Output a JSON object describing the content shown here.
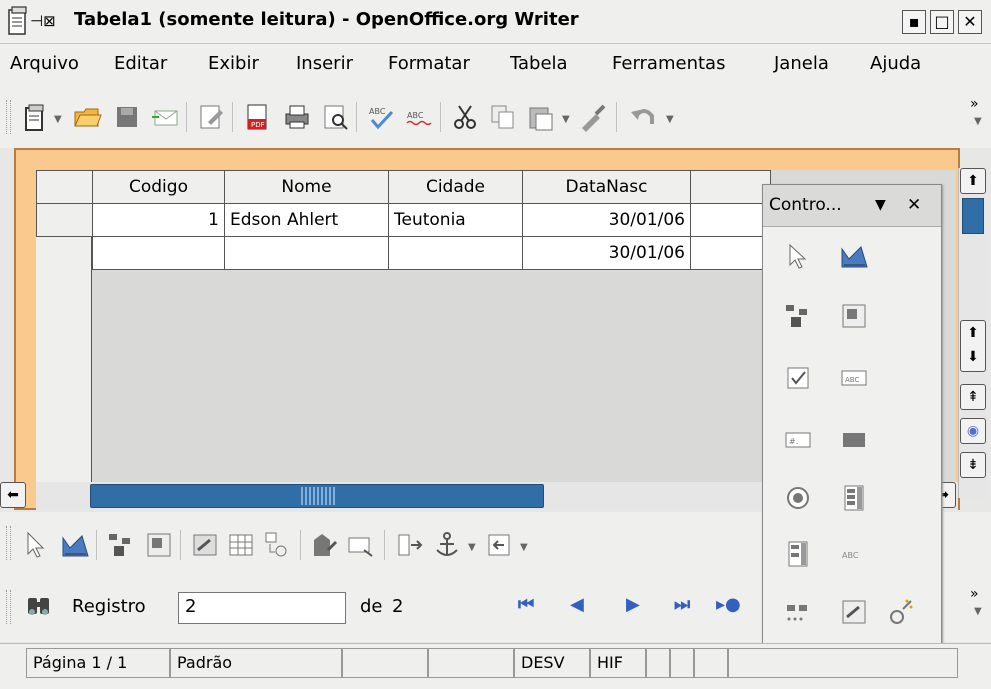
{
  "window": {
    "title": "Tabela1 (somente leitura) - OpenOffice.org Writer",
    "buttons": [
      "▪",
      "□",
      "✕"
    ]
  },
  "menubar": {
    "items": [
      "Arquivo",
      "Editar",
      "Exibir",
      "Inserir",
      "Formatar",
      "Tabela",
      "Ferramentas",
      "Janela",
      "Ajuda"
    ]
  },
  "table": {
    "headers": [
      "Codigo",
      "Nome",
      "Cidade",
      "DataNasc"
    ],
    "rows": [
      {
        "codigo": "1",
        "nome": "Edson Ahlert",
        "cidade": "Teutonia",
        "datanasc": "30/01/06"
      },
      {
        "codigo": "",
        "nome": "",
        "cidade": "",
        "datanasc": "30/01/06"
      }
    ]
  },
  "controls_panel": {
    "title": "Contro...",
    "close": "✕",
    "menu_arrow": "▼"
  },
  "navigation": {
    "record_label": "Registro",
    "record_value": "2",
    "of_label": "de",
    "total": "2"
  },
  "statusbar": {
    "page": "Página 1 / 1",
    "style": "Padrão",
    "mode": "DESV",
    "hif": "HIF"
  },
  "colors": {
    "accent": "#2f6ea6",
    "doc_bg": "#f9c98d",
    "nav_blue": "#3260c0"
  }
}
